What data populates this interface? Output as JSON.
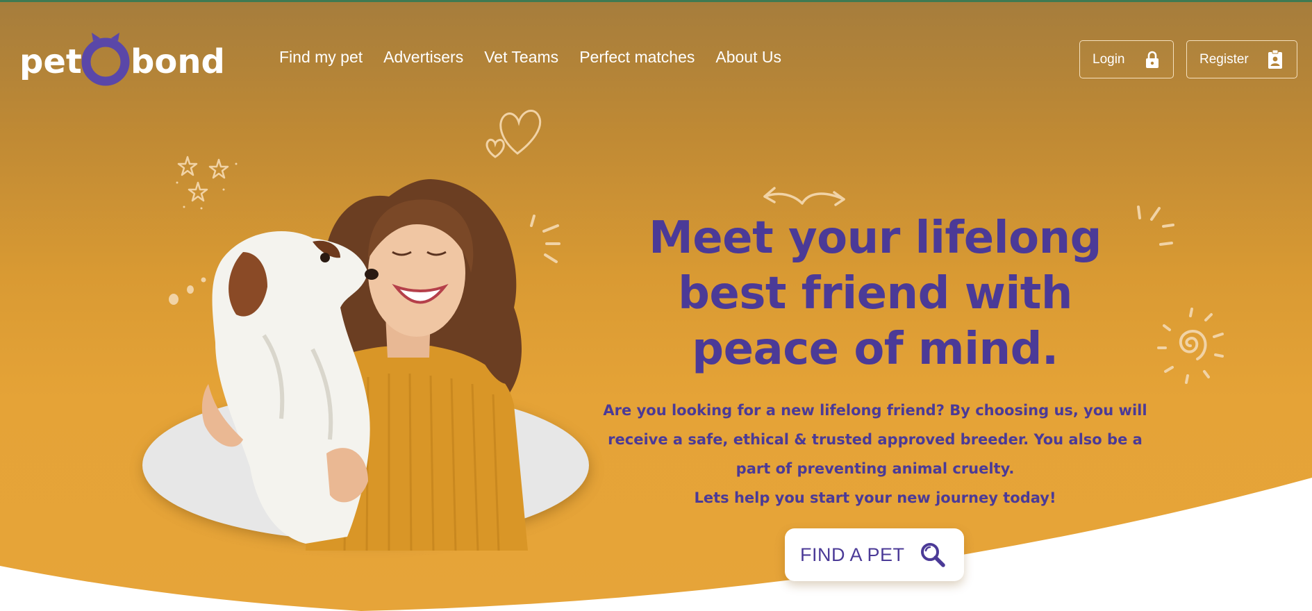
{
  "brand": {
    "logo_text_left": "pet",
    "logo_text_right": "bond",
    "logo_ring_color": "#5a47a8"
  },
  "nav": {
    "items": [
      {
        "label": "Find my pet"
      },
      {
        "label": "Advertisers"
      },
      {
        "label": "Vet Teams"
      },
      {
        "label": "Perfect matches"
      },
      {
        "label": "About Us"
      }
    ]
  },
  "auth": {
    "login_label": "Login",
    "login_icon": "lock-icon",
    "register_label": "Register",
    "register_icon": "id-badge-icon"
  },
  "hero": {
    "headline": "Meet your lifelong best friend with peace of mind.",
    "paragraph": "Are you looking for a new lifelong friend? By choosing us, you will receive a safe, ethical & trusted approved breeder. You also be a part of preventing animal cruelty.",
    "tagline": "Lets help you start your new journey today!",
    "cta_label": "FIND A PET",
    "cta_icon": "search-icon"
  },
  "colors": {
    "primary_purple": "#4b3a97",
    "hero_orange": "#e5a337",
    "header_brown": "#a67d3c",
    "white": "#ffffff"
  }
}
